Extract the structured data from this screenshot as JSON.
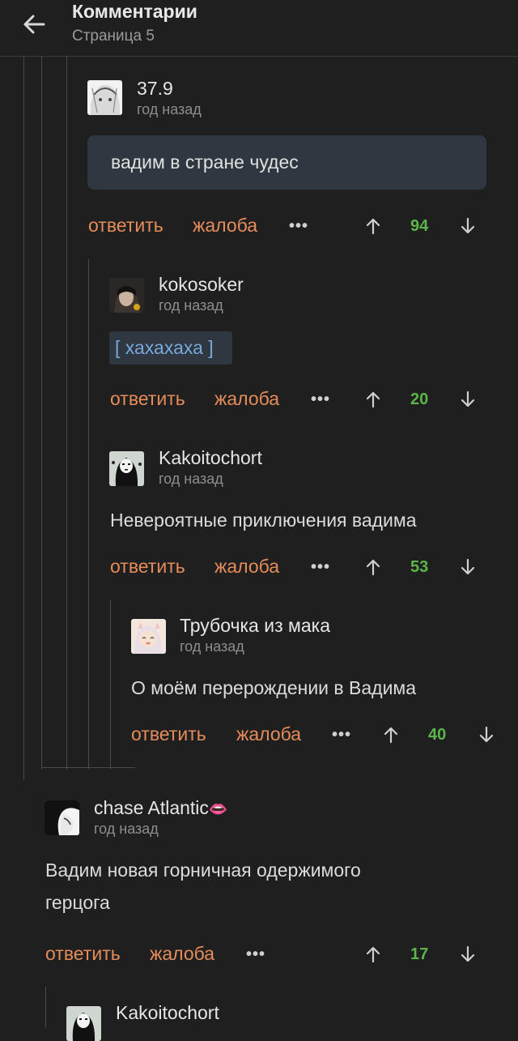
{
  "header": {
    "title": "Комментарии",
    "subtitle": "Страница 5"
  },
  "actions": {
    "reply": "ответить",
    "report": "жалоба",
    "more": "•••"
  },
  "comments": [
    {
      "author": "37.9",
      "time": "год назад",
      "text": "вадим в стране чудес",
      "score": "94"
    },
    {
      "author": "kokosoker",
      "time": "год назад",
      "text": "[ хахахаха ]",
      "score": "20"
    },
    {
      "author": "Kakoitochort",
      "time": "год назад",
      "text": "Невероятные приключения вадима",
      "score": "53"
    },
    {
      "author": "Трубочка из мака",
      "time": "год назад",
      "text": "О моём перерождении в Вадима",
      "score": "40"
    },
    {
      "author": "chase Atlantic",
      "author_emoji": "👄",
      "time": "год назад",
      "text_line1": "Вадим новая горничная одержимого",
      "text_line2": "герцога",
      "score": "17"
    },
    {
      "author": "Kakoitochort"
    }
  ],
  "colors": {
    "background": "#1f1f1f",
    "action": "#e58c5a",
    "score": "#5bb54a",
    "spoiler": "#79a8da",
    "quote_bg": "#2f3740"
  }
}
